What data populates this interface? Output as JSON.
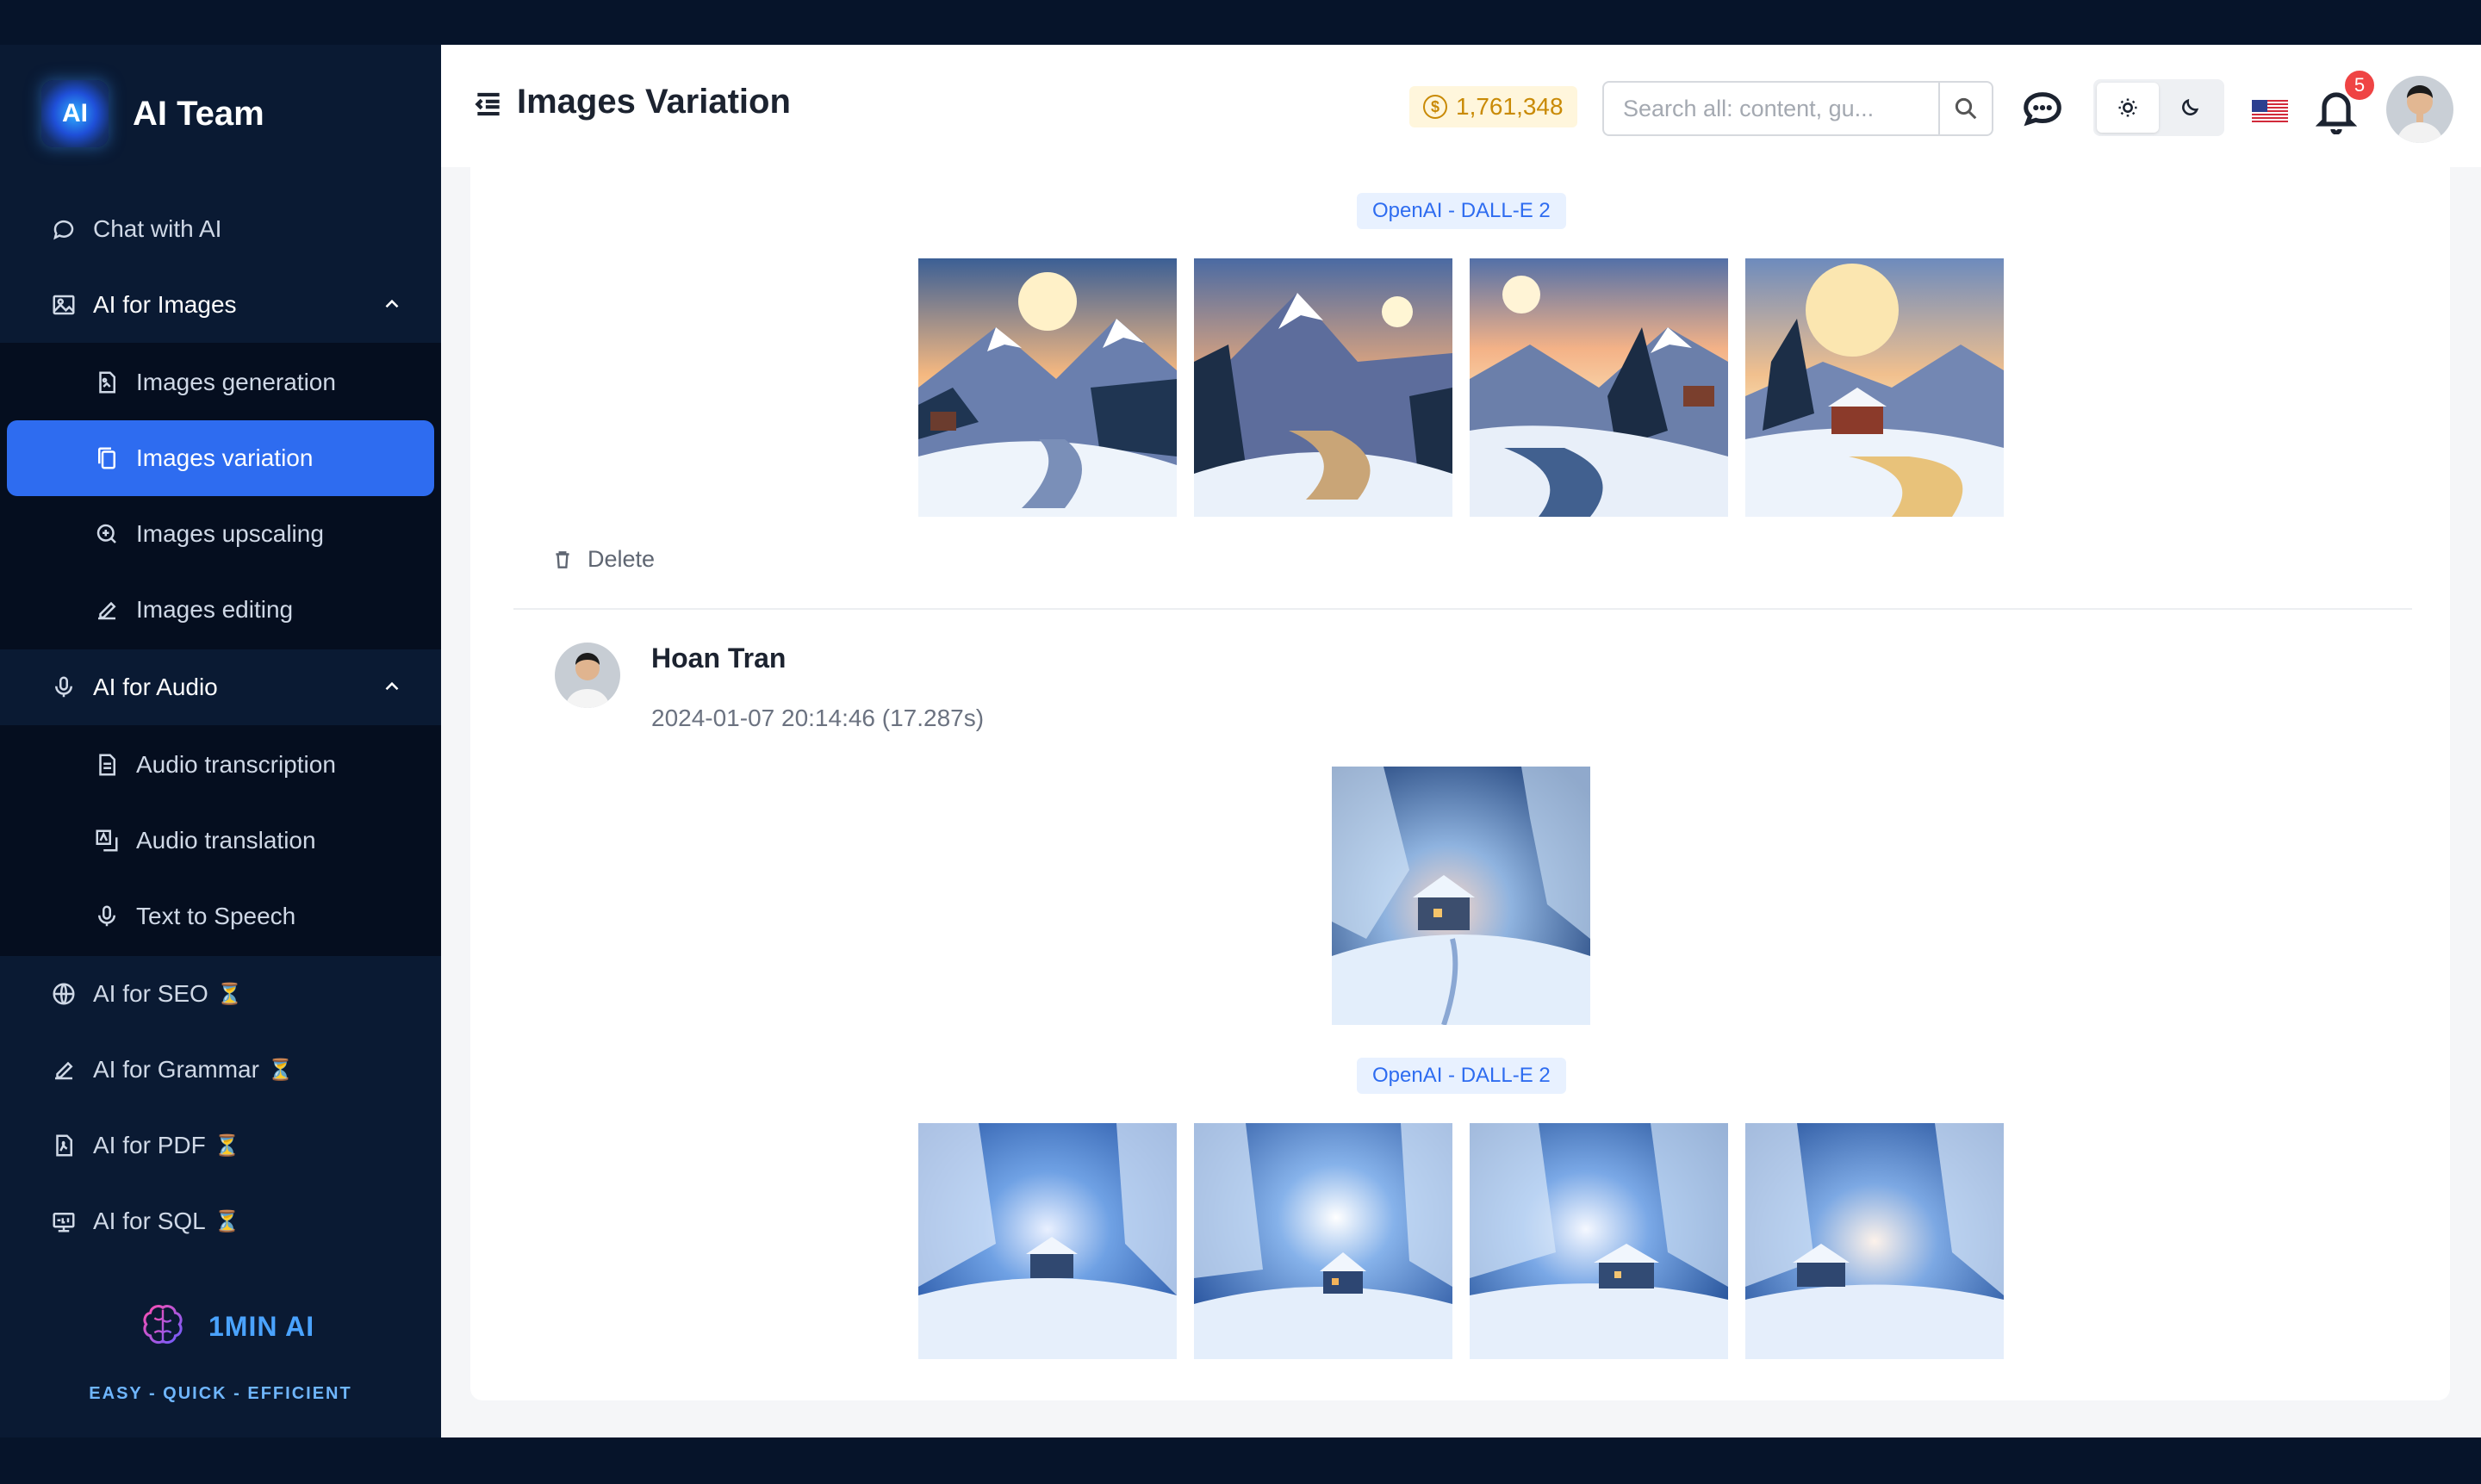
{
  "brand": {
    "name": "AI Team",
    "logo_text": "AI"
  },
  "sidebar": {
    "items": [
      {
        "label": "Chat with AI",
        "icon": "chat-icon"
      },
      {
        "label": "AI for Images",
        "icon": "image-icon",
        "open": true,
        "children": [
          {
            "label": "Images generation",
            "icon": "file-image-icon"
          },
          {
            "label": "Images variation",
            "icon": "copy-icon",
            "active": true
          },
          {
            "label": "Images upscaling",
            "icon": "zoom-in-icon"
          },
          {
            "label": "Images editing",
            "icon": "edit-icon"
          }
        ]
      },
      {
        "label": "AI for Audio",
        "icon": "microphone-icon",
        "open": true,
        "children": [
          {
            "label": "Audio transcription",
            "icon": "file-text-icon"
          },
          {
            "label": "Audio translation",
            "icon": "translate-icon"
          },
          {
            "label": "Text to Speech",
            "icon": "microphone-icon"
          }
        ]
      },
      {
        "label": "AI for SEO",
        "icon": "globe-icon",
        "badge": "⏳"
      },
      {
        "label": "AI for Grammar",
        "icon": "edit-icon",
        "badge": "⏳"
      },
      {
        "label": "AI for PDF",
        "icon": "pdf-icon",
        "badge": "⏳"
      },
      {
        "label": "AI for SQL",
        "icon": "sql-icon",
        "badge": "⏳"
      }
    ],
    "footer": {
      "name": "1MIN AI",
      "tagline": "EASY - QUICK - EFFICIENT"
    }
  },
  "header": {
    "title": "Images Variation",
    "credits": "1,761,348",
    "search_placeholder": "Search all: content, gu...",
    "notification_count": "5"
  },
  "content": {
    "model_tag": "OpenAI - DALL-E 2",
    "delete_label": "Delete",
    "message": {
      "user": "Hoan Tran",
      "timestamp": "2024-01-07 20:14:46 (17.287s)"
    }
  }
}
